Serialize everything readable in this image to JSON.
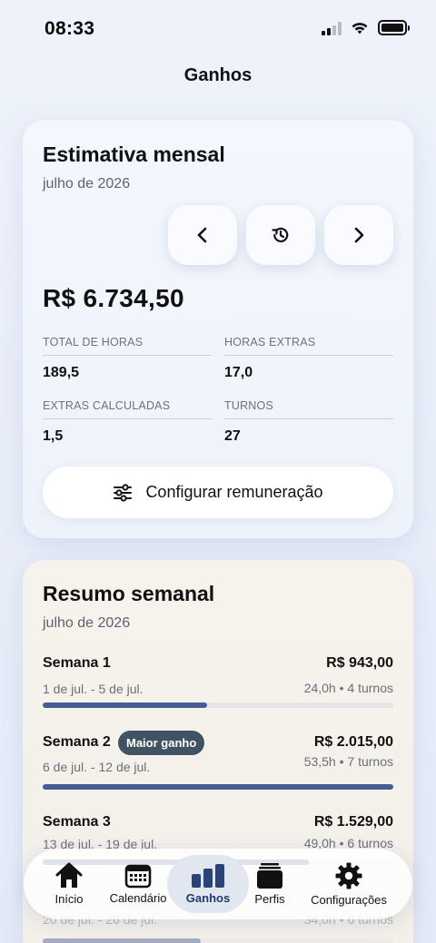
{
  "status": {
    "time": "08:33"
  },
  "header": {
    "title": "Ganhos"
  },
  "estimate": {
    "title": "Estimativa mensal",
    "month": "julho de 2026",
    "amount": "R$ 6.734,50",
    "stats": [
      {
        "label": "TOTAL DE HORAS",
        "value": "189,5"
      },
      {
        "label": "HORAS EXTRAS",
        "value": "17,0"
      },
      {
        "label": "EXTRAS CALCULADAS",
        "value": "1,5"
      },
      {
        "label": "TURNOS",
        "value": "27"
      }
    ],
    "config_label": "Configurar remuneração"
  },
  "weekly": {
    "title": "Resumo semanal",
    "month": "julho de 2026",
    "weeks": [
      {
        "name": "Semana 1",
        "dates": "1 de jul. - 5 de jul.",
        "amount": "R$ 943,00",
        "meta": "24,0h • 4 turnos",
        "progress": 0.47
      },
      {
        "name": "Semana 2",
        "dates": "6 de jul. - 12 de jul.",
        "amount": "R$ 2.015,00",
        "meta": "53,5h • 7 turnos",
        "progress": 1.0,
        "badge": "Maior ganho"
      },
      {
        "name": "Semana 3",
        "dates": "13 de jul. - 19 de jul.",
        "amount": "R$ 1.529,00",
        "meta": "49,0h • 6 turnos",
        "progress": 0.76
      },
      {
        "name": "",
        "dates": "20 de jul. - 26 de jul.",
        "amount": "",
        "meta": "34,0h • 6 turnos",
        "progress": 0.45
      }
    ]
  },
  "tabs": [
    {
      "label": "Início",
      "icon": "home-icon"
    },
    {
      "label": "Calendário",
      "icon": "calendar-icon"
    },
    {
      "label": "Ganhos",
      "icon": "chart-icon",
      "active": true
    },
    {
      "label": "Perfis",
      "icon": "folder-icon"
    },
    {
      "label": "Configurações",
      "icon": "gear-icon"
    }
  ],
  "colors": {
    "accent": "#465d93",
    "badge": "#3f5363"
  }
}
